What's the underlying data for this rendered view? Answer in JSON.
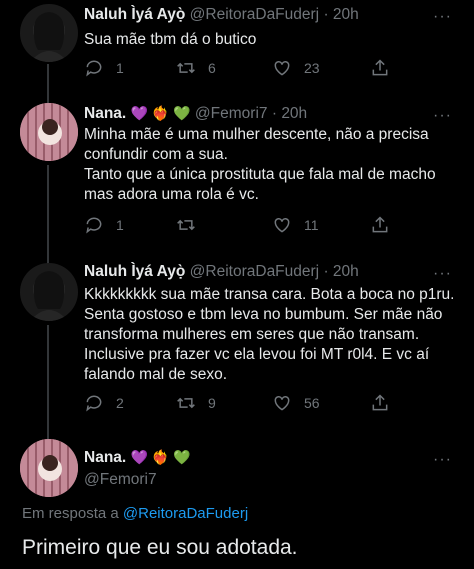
{
  "tweets": [
    {
      "name": "Naluh Ìyá Ayọ̀",
      "handle": "@ReitoraDaFuderj",
      "time": "20h",
      "text": "Sua mãe tbm dá o butico",
      "replies": "1",
      "retweets": "6",
      "likes": "23"
    },
    {
      "name": "Nana.",
      "emojis": "💜 ❤️‍🔥 💚",
      "handle": "@Femori7",
      "time": "20h",
      "text": "Minha mãe é uma mulher descente, não a precisa\nconfundir com a sua.\nTanto que a única prostituta que fala mal de macho\nmas adora uma rola é vc.",
      "replies": "1",
      "retweets": "",
      "likes": "11"
    },
    {
      "name": "Naluh Ìyá Ayọ̀",
      "handle": "@ReitoraDaFuderj",
      "time": "20h",
      "text": "Kkkkkkkkk sua mãe transa cara. Bota a boca no p1ru.\nSenta gostoso e tbm leva no bumbum. Ser mãe não\ntransforma mulheres em seres que não transam.\nInclusive pra fazer vc ela levou foi MT r0l4. E vc aí\nfalando mal de sexo.",
      "replies": "2",
      "retweets": "9",
      "likes": "56"
    }
  ],
  "focused": {
    "name": "Nana.",
    "emojis": "💜 ❤️‍🔥 💚",
    "handle": "@Femori7",
    "reply_prefix": "Em resposta a",
    "reply_to": "@ReitoraDaFuderj",
    "text": "Primeiro que eu sou adotada."
  },
  "separator": "·",
  "more": "···"
}
